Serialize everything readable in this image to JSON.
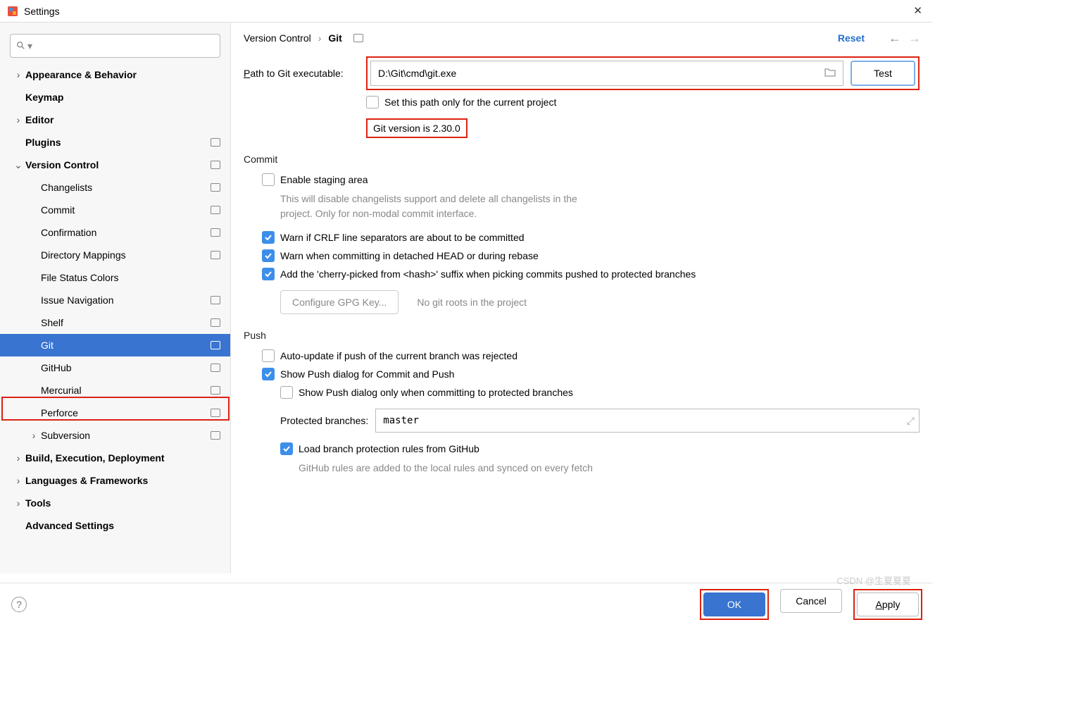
{
  "window": {
    "title": "Settings"
  },
  "breadcrumb": {
    "root": "Version Control",
    "leaf": "Git"
  },
  "reset_label": "Reset",
  "sidebar": {
    "items": [
      {
        "label": "Appearance & Behavior",
        "level": 0,
        "bold": true,
        "chev": "right",
        "badge": false,
        "sel": false
      },
      {
        "label": "Keymap",
        "level": 0,
        "bold": true,
        "chev": "none",
        "badge": false,
        "sel": false
      },
      {
        "label": "Editor",
        "level": 0,
        "bold": true,
        "chev": "right",
        "badge": false,
        "sel": false
      },
      {
        "label": "Plugins",
        "level": 0,
        "bold": true,
        "chev": "none",
        "badge": true,
        "sel": false
      },
      {
        "label": "Version Control",
        "level": 0,
        "bold": true,
        "chev": "down",
        "badge": true,
        "sel": false
      },
      {
        "label": "Changelists",
        "level": 1,
        "bold": false,
        "chev": "none",
        "badge": true,
        "sel": false
      },
      {
        "label": "Commit",
        "level": 1,
        "bold": false,
        "chev": "none",
        "badge": true,
        "sel": false
      },
      {
        "label": "Confirmation",
        "level": 1,
        "bold": false,
        "chev": "none",
        "badge": true,
        "sel": false
      },
      {
        "label": "Directory Mappings",
        "level": 1,
        "bold": false,
        "chev": "none",
        "badge": true,
        "sel": false
      },
      {
        "label": "File Status Colors",
        "level": 1,
        "bold": false,
        "chev": "none",
        "badge": false,
        "sel": false
      },
      {
        "label": "Issue Navigation",
        "level": 1,
        "bold": false,
        "chev": "none",
        "badge": true,
        "sel": false
      },
      {
        "label": "Shelf",
        "level": 1,
        "bold": false,
        "chev": "none",
        "badge": true,
        "sel": false
      },
      {
        "label": "Git",
        "level": 1,
        "bold": false,
        "chev": "none",
        "badge": true,
        "sel": true
      },
      {
        "label": "GitHub",
        "level": 1,
        "bold": false,
        "chev": "none",
        "badge": true,
        "sel": false
      },
      {
        "label": "Mercurial",
        "level": 1,
        "bold": false,
        "chev": "none",
        "badge": true,
        "sel": false
      },
      {
        "label": "Perforce",
        "level": 1,
        "bold": false,
        "chev": "none",
        "badge": true,
        "sel": false
      },
      {
        "label": "Subversion",
        "level": 1,
        "bold": false,
        "chev": "right",
        "badge": true,
        "sel": false
      },
      {
        "label": "Build, Execution, Deployment",
        "level": 0,
        "bold": true,
        "chev": "right",
        "badge": false,
        "sel": false
      },
      {
        "label": "Languages & Frameworks",
        "level": 0,
        "bold": true,
        "chev": "right",
        "badge": false,
        "sel": false
      },
      {
        "label": "Tools",
        "level": 0,
        "bold": true,
        "chev": "right",
        "badge": false,
        "sel": false
      },
      {
        "label": "Advanced Settings",
        "level": 0,
        "bold": true,
        "chev": "none",
        "badge": false,
        "sel": false
      }
    ]
  },
  "git": {
    "path_label_prefix": "P",
    "path_label_rest": "ath to Git executable:",
    "path_value": "D:\\Git\\cmd\\git.exe",
    "test_label": "Test",
    "set_path_project": "Set this path only for the current project",
    "version_text": "Git version is 2.30.0",
    "commit_header": "Commit",
    "enable_staging": "Enable staging area",
    "enable_staging_hint": "This will disable changelists support and delete all changelists in the project. Only for non-modal commit interface.",
    "warn_crlf": "Warn if CRLF line separators are about to be committed",
    "warn_detached": "Warn when committing in detached HEAD or during rebase",
    "cherry_pick": "Add the 'cherry-picked from <hash>' suffix when picking commits pushed to protected branches",
    "gpg_button": "Configure GPG Key...",
    "no_roots": "No git roots in the project",
    "push_header": "Push",
    "auto_update": "Auto-update if push of the current branch was rejected",
    "show_push": "Show Push dialog for Commit and Push",
    "show_push_protected": "Show Push dialog only when committing to protected branches",
    "protected_label": "Protected branches:",
    "protected_value": "master",
    "load_rules": "Load branch protection rules from GitHub",
    "load_rules_hint": "GitHub rules are added to the local rules and synced on every fetch"
  },
  "footer": {
    "ok": "OK",
    "cancel": "Cancel",
    "apply": "Apply"
  },
  "watermark": "CSDN @生夏夏夏"
}
